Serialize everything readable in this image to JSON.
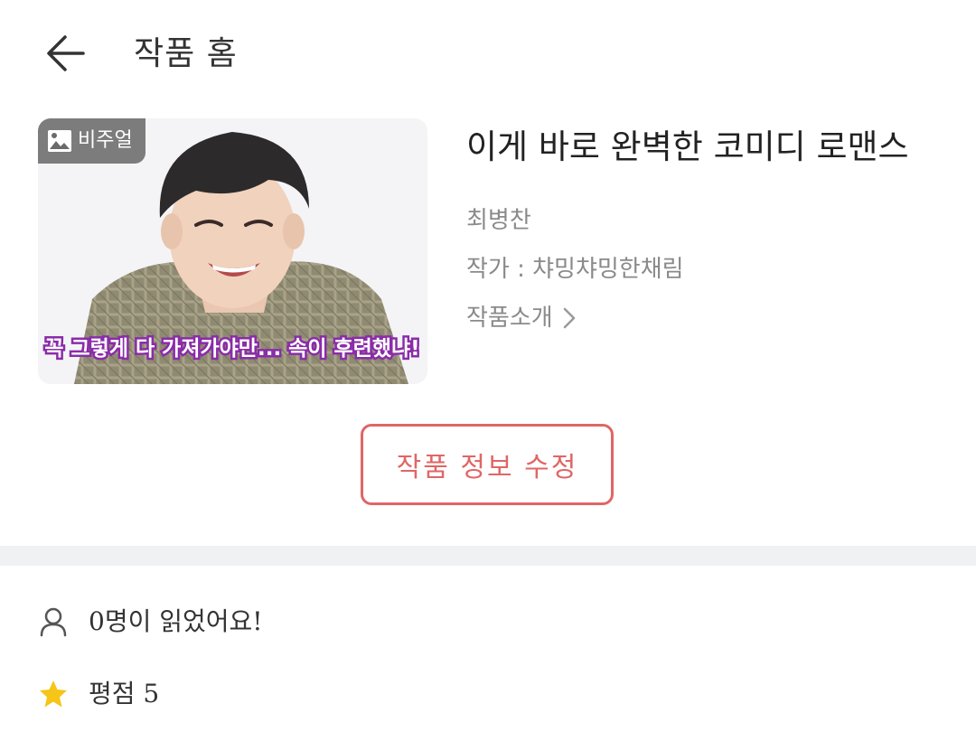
{
  "header": {
    "title": "작품 홈"
  },
  "thumbnail": {
    "badge_label": "비주얼",
    "caption": "꼭 그렇게 다 가져가야만... 속이 후련했냐!"
  },
  "work": {
    "title": "이게 바로 완벽한 코미디 로맨스",
    "creator": "최병찬",
    "author_line": "작가 : 챠밍챠밍한채림",
    "intro_label": "작품소개"
  },
  "edit_button_label": "작품 정보 수정",
  "stats": {
    "reads_text": "0명이 읽었어요!",
    "rating_text": "평점 5"
  },
  "colors": {
    "accent": "#e06666",
    "star": "#f5c518",
    "divider": "#f0f1f3"
  },
  "icons": [
    "back-arrow-icon",
    "image-icon",
    "chevron-right-icon",
    "person-icon",
    "star-icon"
  ]
}
